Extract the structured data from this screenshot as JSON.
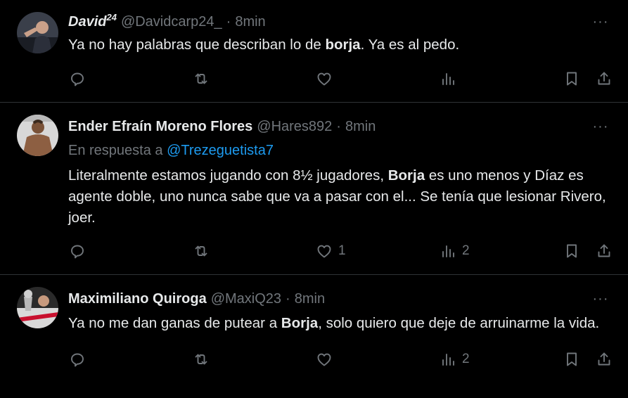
{
  "tweets": [
    {
      "display_name": "David",
      "name_sup": "24",
      "handle": "@Davidcarp24_",
      "dot": "·",
      "time": "8min",
      "reply_prefix": "",
      "reply_to": "",
      "text": [
        {
          "t": "Ya no hay palabras que describan lo de "
        },
        {
          "t": "borja",
          "b": true
        },
        {
          "t": ". Ya es al pedo."
        }
      ],
      "likes": "",
      "views": ""
    },
    {
      "display_name": "Ender Efraín Moreno Flores",
      "name_sup": "",
      "handle": "@Hares892",
      "dot": "·",
      "time": "8min",
      "reply_prefix": "En respuesta a ",
      "reply_to": "@Trezeguetista7",
      "text": [
        {
          "t": "Literalmente estamos jugando con 8½ jugadores, "
        },
        {
          "t": "Borja",
          "b": true
        },
        {
          "t": " es uno menos y Díaz es agente doble, uno nunca sabe que va a pasar con el... Se tenía que lesionar Rivero, joer."
        }
      ],
      "likes": "1",
      "views": "2"
    },
    {
      "display_name": "Maximiliano Quiroga",
      "name_sup": "",
      "handle": "@MaxiQ23",
      "dot": "·",
      "time": "8min",
      "reply_prefix": "",
      "reply_to": "",
      "text": [
        {
          "t": "Ya no me dan ganas de putear a "
        },
        {
          "t": "Borja",
          "b": true
        },
        {
          "t": ", solo quiero que deje de arruinarme la vida."
        }
      ],
      "likes": "",
      "views": "2"
    }
  ],
  "more_glyph": "···",
  "colors": {
    "background": "#000000",
    "text": "#e7e9ea",
    "muted": "#71767b",
    "link": "#1d9bf0",
    "divider": "#2f3336"
  },
  "icons": [
    "reply-icon",
    "retweet-icon",
    "like-icon",
    "views-icon",
    "bookmark-icon",
    "share-icon",
    "more-icon"
  ]
}
